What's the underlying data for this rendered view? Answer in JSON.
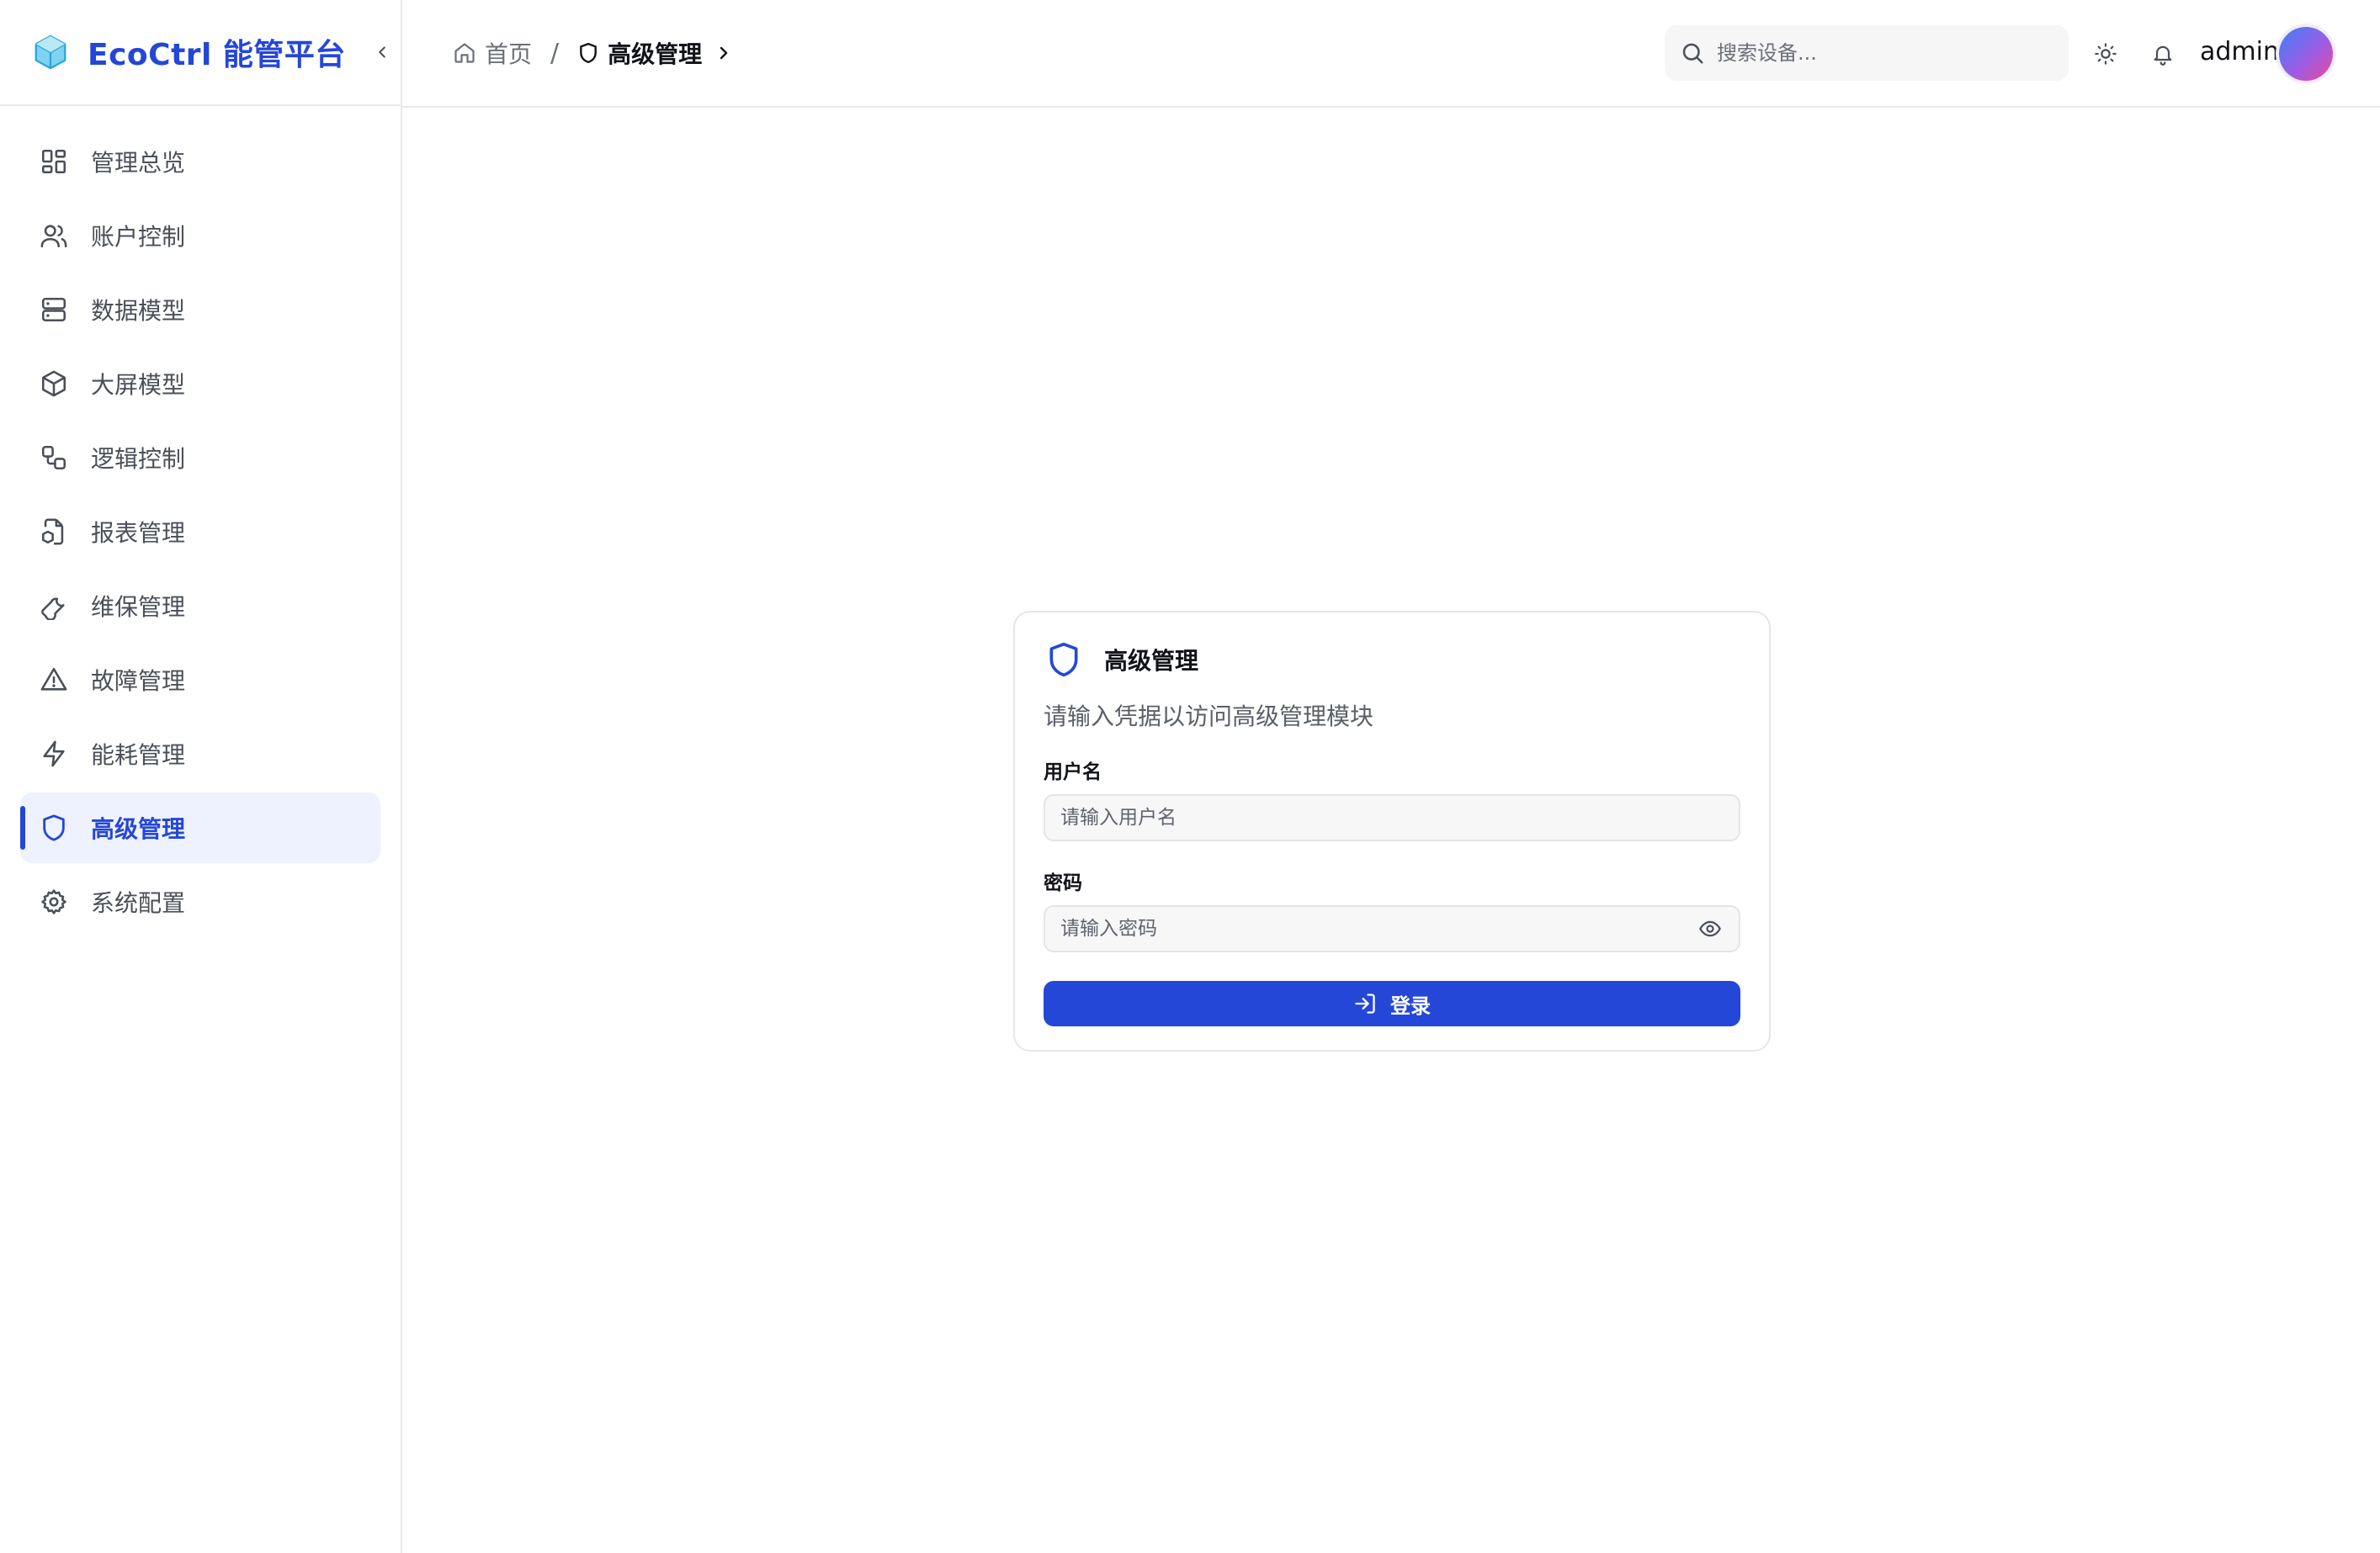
{
  "brand": {
    "title": "EcoCtrl 能管平台",
    "color": "#2447d8"
  },
  "sidebar": {
    "items": [
      {
        "label": "管理总览",
        "icon": "grid-icon"
      },
      {
        "label": "账户控制",
        "icon": "users-icon"
      },
      {
        "label": "数据模型",
        "icon": "server-icon"
      },
      {
        "label": "大屏模型",
        "icon": "box-icon"
      },
      {
        "label": "逻辑控制",
        "icon": "workflow-icon"
      },
      {
        "label": "报表管理",
        "icon": "file-report-icon"
      },
      {
        "label": "维保管理",
        "icon": "wrench-icon"
      },
      {
        "label": "故障管理",
        "icon": "warning-icon"
      },
      {
        "label": "能耗管理",
        "icon": "lightning-icon"
      },
      {
        "label": "高级管理",
        "icon": "shield-icon",
        "active": true
      },
      {
        "label": "系统配置",
        "icon": "gear-icon"
      }
    ]
  },
  "header": {
    "breadcrumb": {
      "home": "首页",
      "separator": "/",
      "current": "高级管理"
    },
    "search": {
      "placeholder": "搜索设备..."
    },
    "username": "admin"
  },
  "login": {
    "title": "高级管理",
    "description": "请输入凭据以访问高级管理模块",
    "username_label": "用户名",
    "username_placeholder": "请输入用户名",
    "password_label": "密码",
    "password_placeholder": "请输入密码",
    "submit_label": "登录"
  }
}
